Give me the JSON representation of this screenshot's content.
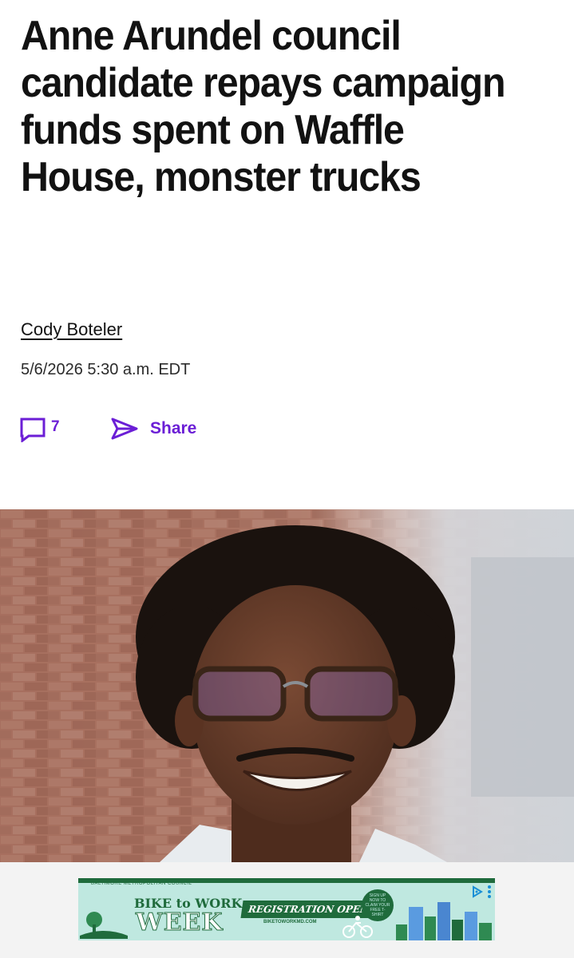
{
  "article": {
    "headline": "Anne Arundel council candidate repays campaign funds spent on Waffle House, monster trucks",
    "author": "Cody Boteler",
    "timestamp": "5/6/2026 5:30 a.m. EDT"
  },
  "actions": {
    "comment_count": "7",
    "share_label": "Share",
    "accent_color": "#6b1ed6"
  },
  "hero_image": {
    "subject": "portrait photo"
  },
  "ad": {
    "small_text": "BALTIMORE METROPOLITAN COUNCIL",
    "title_line1": "BIKE to WORK",
    "title_line2": "WEEK",
    "cta": "REGISTRATION OPEN!",
    "url": "BIKETOWORKMD.COM",
    "badge_text": "SIGN UP NOW TO CLAIM YOUR FREE T-SHIRT",
    "brand_color": "#1f6b3c",
    "background_color": "#bfe8e0"
  }
}
